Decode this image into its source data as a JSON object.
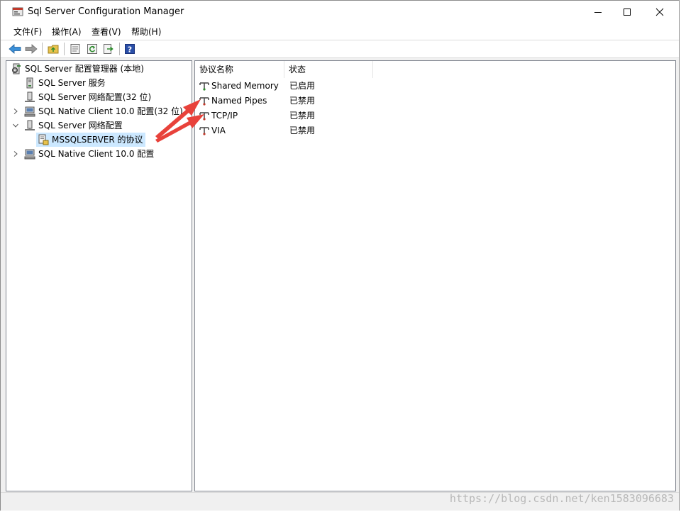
{
  "window": {
    "title": "Sql Server Configuration Manager"
  },
  "menu": [
    {
      "label": "文件(F)"
    },
    {
      "label": "操作(A)"
    },
    {
      "label": "查看(V)"
    },
    {
      "label": "帮助(H)"
    }
  ],
  "tree": {
    "root": "SQL Server 配置管理器 (本地)",
    "items": [
      {
        "label": "SQL Server 服务"
      },
      {
        "label": "SQL Server 网络配置(32 位)"
      },
      {
        "label": "SQL Native Client 10.0 配置(32 位)"
      },
      {
        "label": "SQL Server 网络配置"
      },
      {
        "label": "MSSQLSERVER 的协议"
      },
      {
        "label": "SQL Native Client 10.0 配置"
      }
    ]
  },
  "list": {
    "columns": [
      "协议名称",
      "状态"
    ],
    "rows": [
      {
        "name": "Shared Memory",
        "status": "已启用"
      },
      {
        "name": "Named Pipes",
        "status": "已禁用"
      },
      {
        "name": "TCP/IP",
        "status": "已禁用"
      },
      {
        "name": "VIA",
        "status": "已禁用"
      }
    ]
  },
  "watermark": "https://blog.csdn.net/ken1583096683",
  "colors": {
    "selection": "#cce8ff",
    "annotation_arrow": "#e8423b"
  }
}
